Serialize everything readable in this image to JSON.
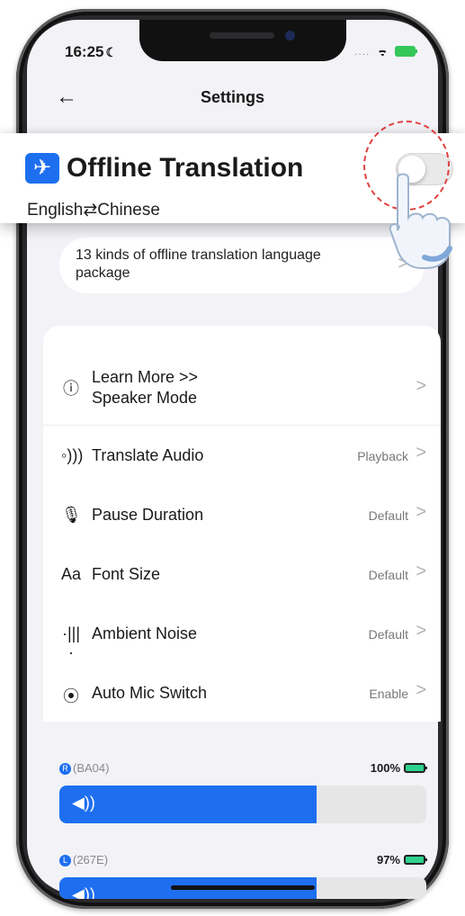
{
  "status": {
    "time": "16:25",
    "dots": "....",
    "moon": "☾"
  },
  "nav": {
    "title": "Settings",
    "back": "←"
  },
  "offline": {
    "title": "Offline Translation",
    "languages": "English⇄Chinese",
    "toggle_on": false,
    "package_text": "13 kinds of offline translation language package"
  },
  "settings": {
    "learn_more": "Learn More >>",
    "speaker_mode": "Speaker Mode",
    "items": [
      {
        "label": "Translate Audio",
        "value": "Playback",
        "icon": "audio-waves-icon"
      },
      {
        "label": "Pause Duration",
        "value": "Default",
        "icon": "microphone-icon"
      },
      {
        "label": "Font Size",
        "value": "Default",
        "icon": "font-size-icon"
      },
      {
        "label": "Ambient Noise",
        "value": "Default",
        "icon": "noise-icon"
      },
      {
        "label": "Auto Mic Switch",
        "value": "Enable",
        "icon": "mic-switch-icon"
      }
    ]
  },
  "devices": [
    {
      "badge": "R",
      "id": "(BA04)",
      "battery": "100%",
      "volume": 0.7
    },
    {
      "badge": "L",
      "id": "(267E)",
      "battery": "97%",
      "volume": 0.7
    }
  ],
  "colors": {
    "accent": "#1e6ff0",
    "battery": "#2fd18f",
    "highlight_circle": "#e04040"
  }
}
